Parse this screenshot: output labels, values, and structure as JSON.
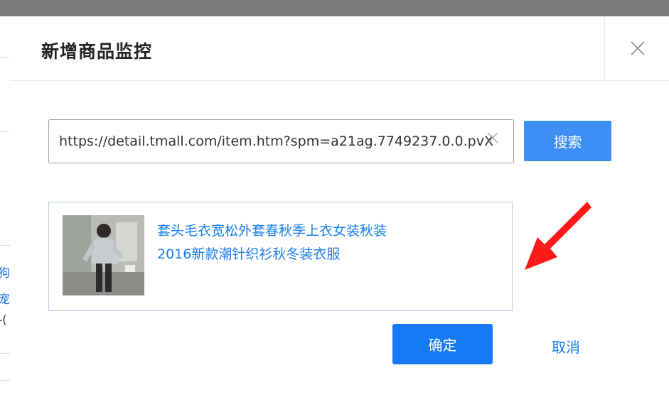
{
  "background": {
    "fragments": [
      "狗",
      "宠",
      "-("
    ]
  },
  "dialog": {
    "title": "新增商品监控",
    "close_icon": "close-icon"
  },
  "search": {
    "value": "https://detail.tmall.com/item.htm?spm=a21ag.7749237.0.0.pvX",
    "clear_icon": "clear-icon",
    "button_label": "搜索"
  },
  "result": {
    "title_line1": "套头毛衣宽松外套春秋季上衣女装秋装",
    "title_line2": "2016新款潮针织衫秋冬装衣服"
  },
  "footer": {
    "confirm_label": "确定",
    "cancel_label": "取消"
  },
  "colors": {
    "primary": "#1679f5",
    "link": "#1a7ef0",
    "annotation": "#ff1a1a"
  }
}
